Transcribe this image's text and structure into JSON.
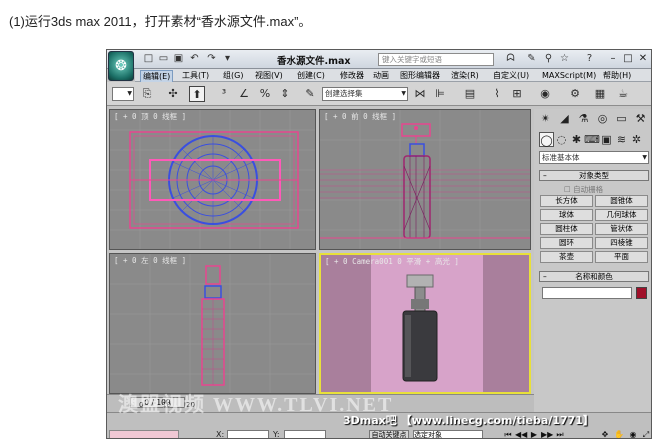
{
  "caption": "(1)运行3ds max 2011，打开素材“香水源文件.max”。",
  "window": {
    "title": "香水源文件.max",
    "search_placeholder": "键入关键字或短语",
    "logo_glyph": "❂"
  },
  "menu": {
    "items": [
      "编辑(E)",
      "工具(T)",
      "组(G)",
      "视图(V)",
      "创建(C)",
      "修改器",
      "动画",
      "图形编辑器",
      "渲染(R)",
      "自定义(U)",
      "MAXScript(M)",
      "帮助(H)"
    ]
  },
  "toolbar": {
    "selection_set_placeholder": "创建选择集"
  },
  "viewports": {
    "top_left": "[ + 0 顶 0 线框 ]",
    "top_right": "[ + 0 前 0 线框 ]",
    "bottom_left": "[ + 0 左 0 线框 ]",
    "bottom_right": "[ + 0 Camera001 0 平滑 + 高光 ]"
  },
  "command_panel": {
    "category": "标准基本体",
    "object_type_title": "对象类型",
    "auto_grid": "自动栅格",
    "buttons": [
      "长方体",
      "圆锥体",
      "球体",
      "几何球体",
      "圆柱体",
      "管状体",
      "圆环",
      "四棱锥",
      "茶壶",
      "平面"
    ],
    "name_color_title": "名称和颜色",
    "object_color": "#a0102a"
  },
  "timeline": {
    "frame": "0 / 100",
    "ticks": [
      "0",
      "10",
      "20"
    ]
  },
  "status": {
    "x_label": "X:",
    "y_label": "Y:",
    "auto_key": "自动关键点",
    "selected": "选定对象"
  },
  "watermark": {
    "text": "澳盟视频 WWW.TLVI.NET",
    "credit": "3Dmax吧 【www.linecg.com/tieba/1771】"
  },
  "colors": {
    "accent_pink": "#e8468f",
    "wire_blue": "#3a4fe0",
    "active_border": "#e8e03a"
  }
}
